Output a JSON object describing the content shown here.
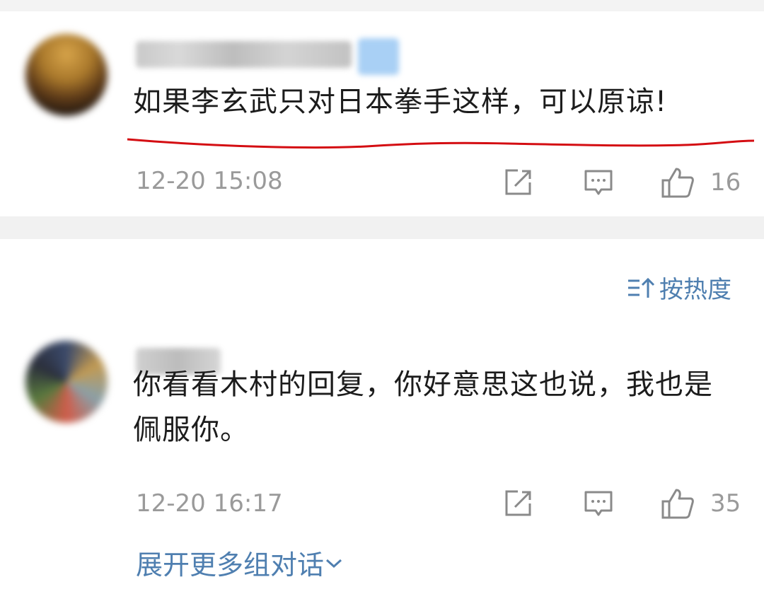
{
  "comments": [
    {
      "text": "如果李玄武只对日本拳手这样，可以原谅!",
      "time": "12-20 15:08",
      "likes": "16"
    },
    {
      "text": "你看看木村的回复，你好意思这也说，我也是佩服你。",
      "time": "12-20 16:17",
      "likes": "35"
    }
  ],
  "sort": {
    "label": "按热度"
  },
  "expand": {
    "label": "展开更多组对话"
  },
  "colors": {
    "link": "#4f7fb0",
    "underline": "#d40d12",
    "meta": "#9a9a9a"
  },
  "icons": [
    "share-icon",
    "comment-icon",
    "like-icon",
    "sort-icon",
    "chevron-down-icon"
  ]
}
